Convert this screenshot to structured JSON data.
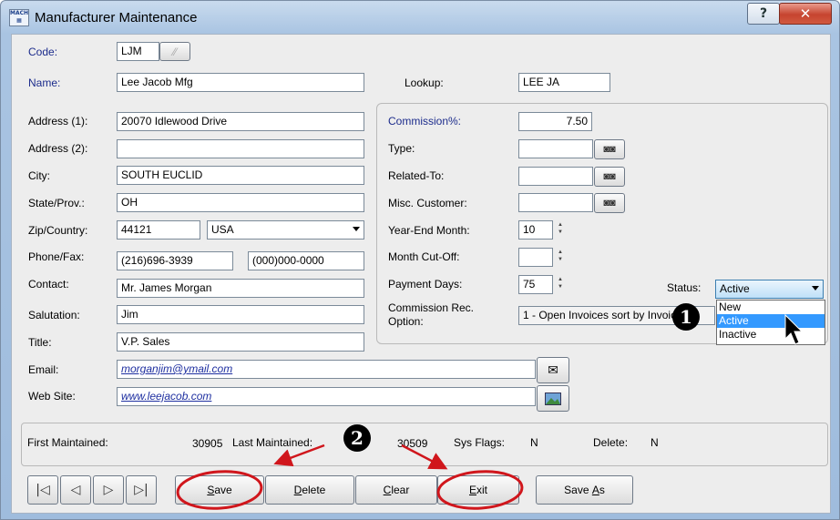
{
  "window": {
    "app_icon": "mach-app-icon",
    "title": "Manufacturer Maintenance",
    "help_label": "?",
    "close_label": "✕"
  },
  "form": {
    "code": {
      "label": "Code:",
      "value": "LJM"
    },
    "name": {
      "label": "Name:",
      "value": "Lee Jacob Mfg"
    },
    "lookup": {
      "label": "Lookup:",
      "value": "LEE JA"
    },
    "address1": {
      "label": "Address (1):",
      "value": "20070 Idlewood Drive"
    },
    "address2": {
      "label": "Address (2):",
      "value": ""
    },
    "city": {
      "label": "City:",
      "value": "SOUTH EUCLID"
    },
    "state": {
      "label": "State/Prov.:",
      "value": "OH"
    },
    "zip_country": {
      "label": "Zip/Country:",
      "zip": "44121",
      "country": "USA"
    },
    "phone_fax": {
      "label": "Phone/Fax:",
      "phone": "(216)696-3939",
      "fax": "(000)000-0000"
    },
    "contact": {
      "label": "Contact:",
      "value": "Mr. James Morgan"
    },
    "salutation": {
      "label": "Salutation:",
      "value": "Jim"
    },
    "title_field": {
      "label": "Title:",
      "value": "V.P. Sales"
    },
    "email": {
      "label": "Email:",
      "value": "morganjim@ymail.com"
    },
    "website": {
      "label": "Web Site:",
      "value": "www.leejacob.com"
    }
  },
  "commission": {
    "commission_pct": {
      "label": "Commission%:",
      "value": "7.50"
    },
    "type": {
      "label": "Type:",
      "value": ""
    },
    "related_to": {
      "label": "Related-To:",
      "value": ""
    },
    "misc_customer": {
      "label": "Misc. Customer:",
      "value": ""
    },
    "year_end_month": {
      "label": "Year-End Month:",
      "value": "10"
    },
    "month_cutoff": {
      "label": "Month Cut-Off:",
      "value": ""
    },
    "payment_days": {
      "label": "Payment Days:",
      "value": "75"
    },
    "rec_option": {
      "label_line1": "Commission Rec.",
      "label_line2": "Option:",
      "value": "1 - Open Invoices sort by Invoice"
    },
    "status": {
      "label": "Status:",
      "value": "Active",
      "options": [
        "New",
        "Active",
        "Inactive"
      ]
    }
  },
  "footer_info": {
    "first_maintained_label": "First Maintained:",
    "first_maintained_value": "30905",
    "last_maintained_label": "Last Maintained:",
    "last_maintained_value": "30509",
    "sys_flags_label": "Sys Flags:",
    "sys_flags_value": "N",
    "delete_label": "Delete:",
    "delete_value": "N"
  },
  "navigation": {
    "first": "|◁",
    "prev": "◁",
    "next": "▷",
    "last": "▷|"
  },
  "actions": {
    "save_hot": "S",
    "save_rest": "ave",
    "delete_hot": "D",
    "delete_rest": "elete",
    "clear_hot": "C",
    "clear_rest": "lear",
    "exit_hot": "E",
    "exit_rest": "xit",
    "save_as_pre": "Save ",
    "save_as_hot": "A",
    "save_as_rest": "s"
  },
  "callouts": {
    "one": "1",
    "two": "2"
  },
  "colors": {
    "annotation_red": "#d0161c",
    "selection_blue": "#3399ff"
  }
}
